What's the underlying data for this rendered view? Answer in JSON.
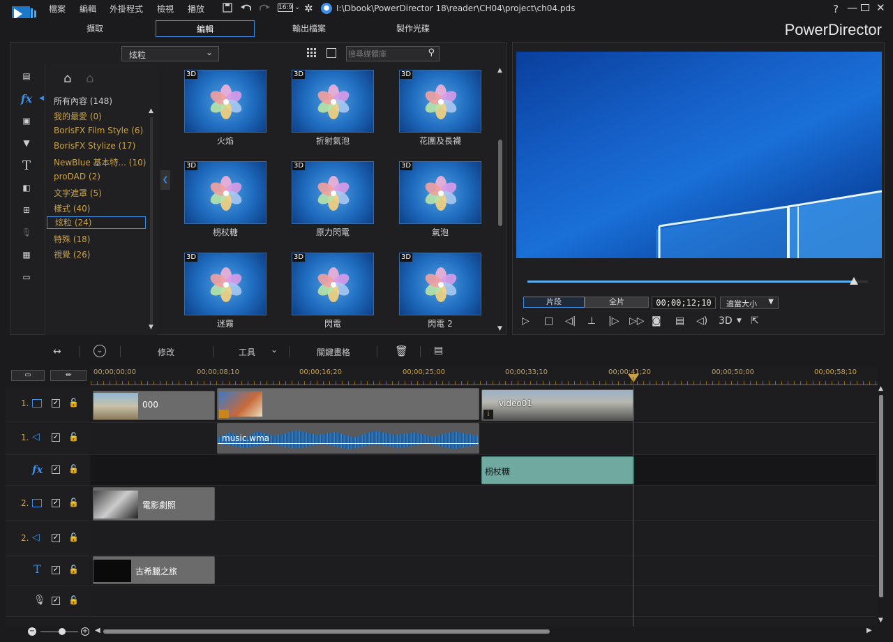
{
  "menus": [
    "檔案",
    "編輯",
    "外掛程式",
    "檢視",
    "播放"
  ],
  "titlebar": {
    "aspect": "16:9",
    "path": "I:\\Dbook\\PowerDirector 18\\reader\\CH04\\project\\ch04.pds",
    "help": "?"
  },
  "modes": [
    {
      "label": "擷取"
    },
    {
      "label": "編輯",
      "active": true
    },
    {
      "label": "輸出檔案"
    },
    {
      "label": "製作光碟"
    }
  ],
  "brand": "PowerDirector",
  "library": {
    "dropdown_value": "炫粒",
    "search_placeholder": "搜尋媒體庫",
    "categories": [
      {
        "label": "所有內容 (148)"
      },
      {
        "label": "我的最愛  (0)"
      },
      {
        "label": "BorisFX Film Style  (6)"
      },
      {
        "label": "BorisFX Stylize  (17)"
      },
      {
        "label": "NewBlue 基本特...  (10)"
      },
      {
        "label": "proDAD  (2)"
      },
      {
        "label": "文字遮罩  (5)"
      },
      {
        "label": "樣式  (40)"
      },
      {
        "label": "炫粒  (24)"
      },
      {
        "label": "特殊  (18)"
      },
      {
        "label": "視覺  (26)"
      }
    ],
    "effects": [
      {
        "badge": "3D",
        "name": "火焰"
      },
      {
        "badge": "3D",
        "name": "折射氣泡"
      },
      {
        "badge": "3D",
        "name": "花團及長襪"
      },
      {
        "badge": "3D",
        "name": "枴杖糖"
      },
      {
        "badge": "3D",
        "name": "原力閃電"
      },
      {
        "badge": "3D",
        "name": "氣泡"
      },
      {
        "badge": "3D",
        "name": "迷霧"
      },
      {
        "badge": "3D",
        "name": "閃電"
      },
      {
        "badge": "3D",
        "name": "閃電 2"
      }
    ]
  },
  "preview": {
    "clip_mode": "片段",
    "movie_mode": "全片",
    "timecode": "00;00;12;10",
    "fit": "適當大小",
    "stereo": "3D",
    "progress": 0.96
  },
  "timeline_toolbar": {
    "modify": "修改",
    "tools": "工具",
    "keyframe": "關鍵畫格"
  },
  "ruler": [
    "00;00;00;00",
    "00;00;08;10",
    "00;00;16;20",
    "00;00;25;00",
    "00;00;33;10",
    "00;00;41;20",
    "00;00;50;00",
    "00;00;58;10"
  ],
  "tracks": [
    {
      "num": "1.",
      "kind": "video",
      "clips": [
        {
          "name": "000"
        },
        {
          "name": ""
        },
        {
          "name": "video01"
        }
      ]
    },
    {
      "num": "1.",
      "kind": "audio",
      "clips": [
        {
          "name": "music.wma"
        }
      ]
    },
    {
      "num": "",
      "kind": "fx",
      "clips": [
        {
          "name": "枴杖糖"
        }
      ]
    },
    {
      "num": "2.",
      "kind": "video",
      "clips": [
        {
          "name": "電影劇照"
        }
      ]
    },
    {
      "num": "2.",
      "kind": "audio",
      "clips": []
    },
    {
      "num": "",
      "kind": "title",
      "clips": [
        {
          "name": "古希臘之旅"
        }
      ]
    },
    {
      "num": "",
      "kind": "voice",
      "clips": []
    }
  ],
  "colors": {
    "accent": "#3a8ee6",
    "label_gold": "#c9a24a",
    "playhead": "#c0261f",
    "fx_clip": "#6fa9a0"
  }
}
